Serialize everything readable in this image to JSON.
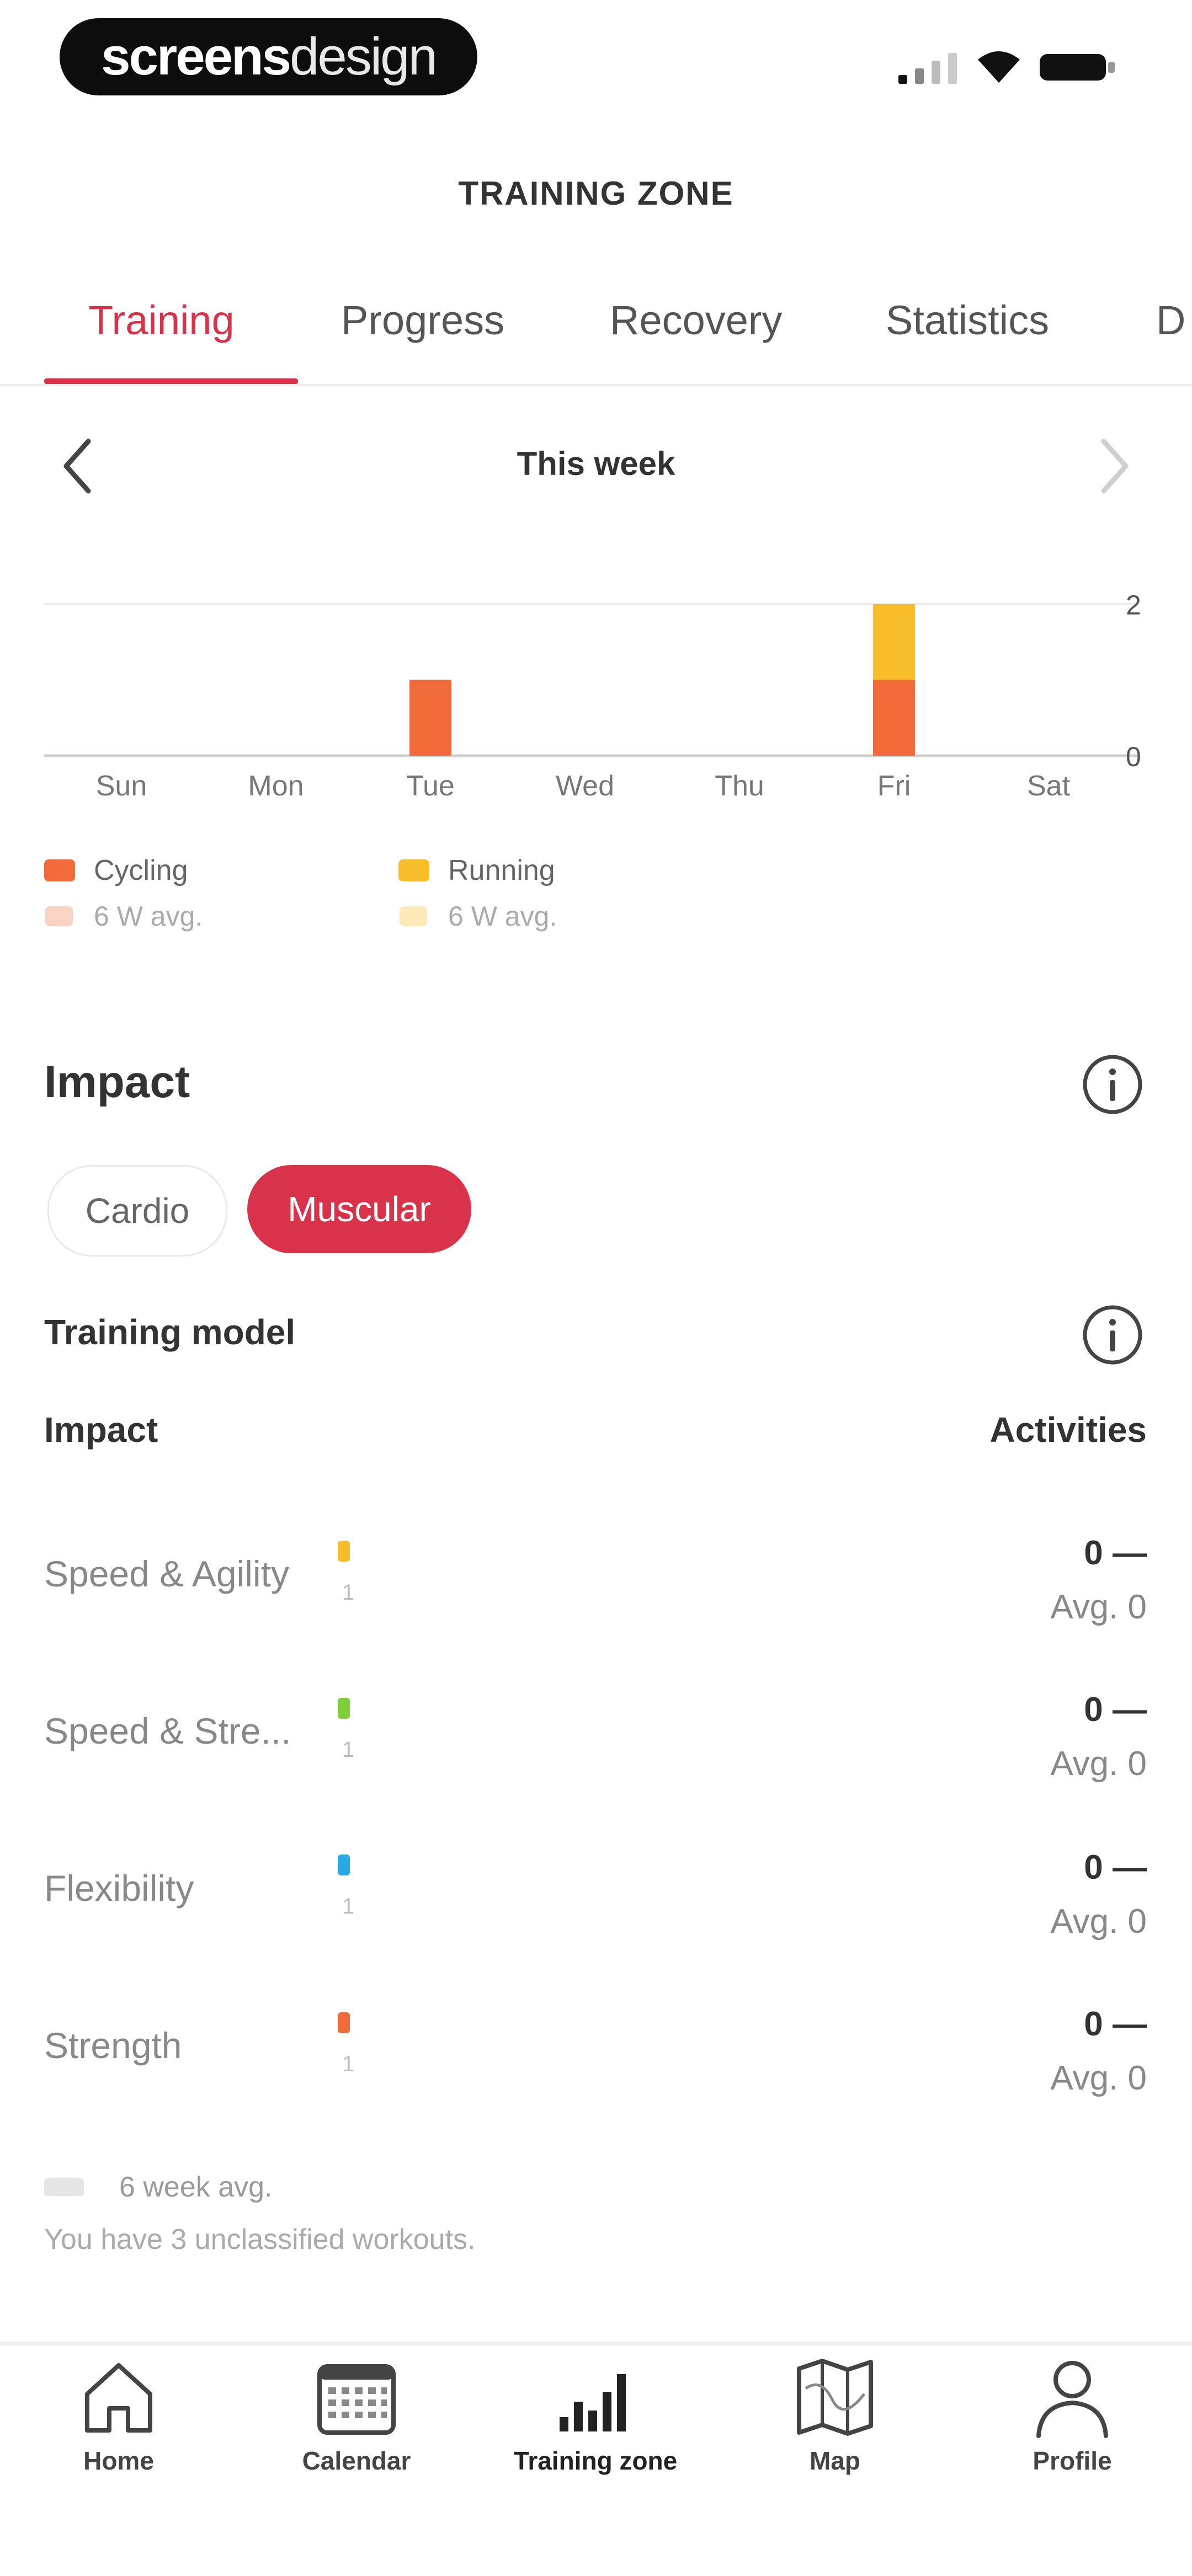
{
  "status_bar": {
    "brand_bold": "screens",
    "brand_light": "design"
  },
  "header": {
    "title": "TRAINING ZONE"
  },
  "tabs": [
    {
      "label": "Training",
      "active": true
    },
    {
      "label": "Progress",
      "active": false
    },
    {
      "label": "Recovery",
      "active": false
    },
    {
      "label": "Statistics",
      "active": false
    },
    {
      "label": "D",
      "active": false
    }
  ],
  "week": {
    "label": "This week"
  },
  "chart_data": {
    "type": "bar",
    "stacked": true,
    "categories": [
      "Sun",
      "Mon",
      "Tue",
      "Wed",
      "Thu",
      "Fri",
      "Sat"
    ],
    "series": [
      {
        "name": "Cycling",
        "color": "#f26b3a",
        "values": [
          0,
          0,
          1,
          0,
          0,
          1,
          0
        ]
      },
      {
        "name": "Running",
        "color": "#f7bd2b",
        "values": [
          0,
          0,
          0,
          0,
          0,
          1,
          0
        ]
      }
    ],
    "ylim": [
      0,
      2
    ],
    "yticks": [
      "0",
      "2"
    ],
    "grid": true,
    "legend": [
      {
        "name": "Cycling",
        "sub": "6 W avg.",
        "color": "#f26b3a",
        "light_color": "#fbd3c3"
      },
      {
        "name": "Running",
        "sub": "6 W avg.",
        "color": "#f7bd2b",
        "light_color": "#fde9b8"
      }
    ]
  },
  "impact": {
    "title": "Impact",
    "toggle": {
      "cardio": "Cardio",
      "muscular": "Muscular",
      "selected": "Muscular"
    },
    "training_model_label": "Training model",
    "col_impact": "Impact",
    "col_activities": "Activities",
    "rows": [
      {
        "label": "Speed & Agility",
        "color": "#f7bd2b",
        "sub": "1",
        "value": "0 —",
        "avg": "Avg. 0"
      },
      {
        "label": "Speed & Stre...",
        "color": "#7fcf3a",
        "sub": "1",
        "value": "0 —",
        "avg": "Avg. 0"
      },
      {
        "label": "Flexibility",
        "color": "#29aae1",
        "sub": "1",
        "value": "0 —",
        "avg": "Avg. 0"
      },
      {
        "label": "Strength",
        "color": "#f26b3a",
        "sub": "1",
        "value": "0 —",
        "avg": "Avg. 0"
      }
    ],
    "footer_legend": "6 week avg.",
    "footer_note": "You have 3 unclassified workouts."
  },
  "nav": [
    {
      "label": "Home",
      "icon": "home-icon",
      "active": false
    },
    {
      "label": "Calendar",
      "icon": "calendar-icon",
      "active": false
    },
    {
      "label": "Training zone",
      "icon": "bar-chart-icon",
      "active": true
    },
    {
      "label": "Map",
      "icon": "map-icon",
      "active": false
    },
    {
      "label": "Profile",
      "icon": "profile-icon",
      "active": false
    }
  ]
}
